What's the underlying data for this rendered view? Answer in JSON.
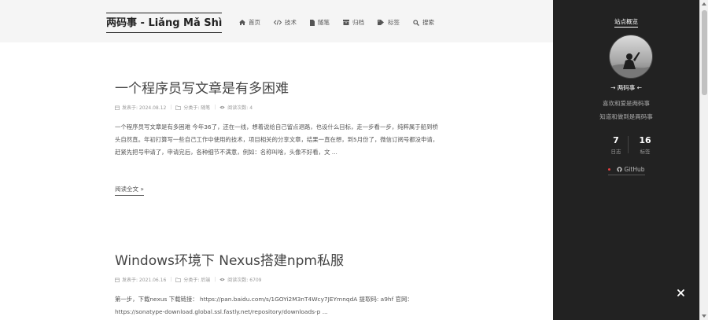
{
  "brand": {
    "title": "两码事 - Liǎng Mǎ Shì"
  },
  "nav": [
    {
      "label": "首页",
      "icon": "home-icon"
    },
    {
      "label": "技术",
      "icon": "code-icon"
    },
    {
      "label": "随笔",
      "icon": "file-icon"
    },
    {
      "label": "归档",
      "icon": "archive-icon"
    },
    {
      "label": "标签",
      "icon": "tag-icon"
    },
    {
      "label": "搜索",
      "icon": "search-icon"
    }
  ],
  "posts": [
    {
      "title": "一个程序员写文章是有多困难",
      "date": "发表于: 2024.08.12",
      "category": "分类于: 随笔",
      "views": "阅读次数: 4",
      "excerpt": "一个程序员写文章是有多困难 今年36了，还在一线，想着说给自己留点退路，也设什么目标，走一步看一步，纯粹属于船到桥头自然直。年初打算写一些自己工作中使用的技术，项目相关的分享文章，结果一直在想，到5月份了，微信订阅号都没申请，赶紧先把号申请了，申请完后，各种细节不满意，例如：名称叫啥，头像不好看，文 ...",
      "more": "阅读全文 »"
    },
    {
      "title": "Windows环境下 Nexus搭建npm私服",
      "date": "发表于: 2021.06.16",
      "category": "分类于: 后端",
      "views": "阅读次数: 6709",
      "excerpt": "第一步，下载nexus 下载链接： https://pan.baidu.com/s/1GOYi2M3nT4Wcy7JEYmnqdA 提取码: a9hf 官网： https://sonatype-download.global.ssl.fastly.net/repository/downloads-p ..."
    }
  ],
  "sidebar": {
    "title": "站点概览",
    "author": "→ 两码事 ←",
    "desc1": "喜欢和爱是两码事",
    "desc2": "知道和做到是两码事",
    "stats": [
      {
        "num": "7",
        "label": "日志"
      },
      {
        "num": "16",
        "label": "标签"
      }
    ],
    "github": "GitHub"
  },
  "colors": {
    "sidebar_bg": "#222222",
    "header_bg": "#f5f5f5",
    "accent_dot": "#e04040"
  }
}
